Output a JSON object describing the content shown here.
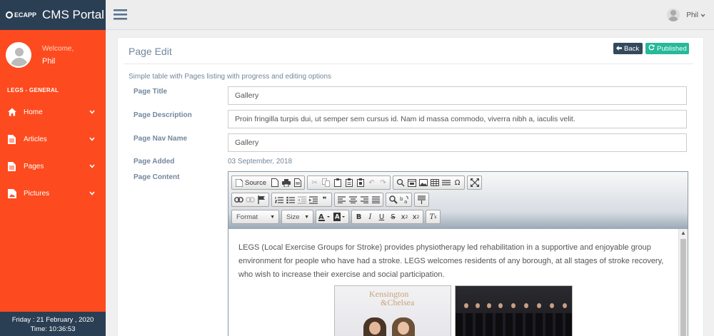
{
  "sidebar": {
    "brand_logo": "ECAPP",
    "brand_title": "CMS Portal",
    "welcome": "Welcome,",
    "user_name": "Phil",
    "section_title": "LEGS - GENERAL",
    "items": [
      {
        "label": "Home",
        "icon": "home-icon"
      },
      {
        "label": "Articles",
        "icon": "document-icon"
      },
      {
        "label": "Pages",
        "icon": "document-icon"
      },
      {
        "label": "Pictures",
        "icon": "picture-icon"
      }
    ],
    "footer": {
      "date": "Friday : 21 February , 2020",
      "time": "Time: 10:36:53"
    }
  },
  "topbar": {
    "user_name": "Phil"
  },
  "panel": {
    "title": "Page Edit",
    "back_label": "Back",
    "published_label": "Published",
    "subtitle": "Simple table with Pages listing with progress and editing options",
    "colors": {
      "back": "#34495e",
      "published": "#26b99a",
      "sidebar": "#fd4a1e",
      "brand": "#2a3f54"
    }
  },
  "form": {
    "page_title_label": "Page Title",
    "page_title_value": "Gallery",
    "page_description_label": "Page Description",
    "page_description_value": "Proin fringilla turpis dui, ut semper sem cursus id. Nam id massa commodo, viverra nibh a, iaculis velit.",
    "page_nav_label": "Page Nav Name",
    "page_nav_value": "Gallery",
    "page_added_label": "Page Added",
    "page_added_value": "03 September, 2018",
    "page_content_label": "Page Content"
  },
  "editor": {
    "source_label": "Source",
    "format_label": "Format",
    "size_label": "Size",
    "content_text": "LEGS (Local Exercise Groups for Stroke) provides physiotherapy led rehabilitation in a supportive and enjoyable group environment for people who have had a stroke. LEGS welcomes residents of any borough, at all stages of stroke recovery, who wish to increase their exercise and social participation.",
    "image1_text1": "Kensington",
    "image1_text2": "&Chelsea"
  }
}
